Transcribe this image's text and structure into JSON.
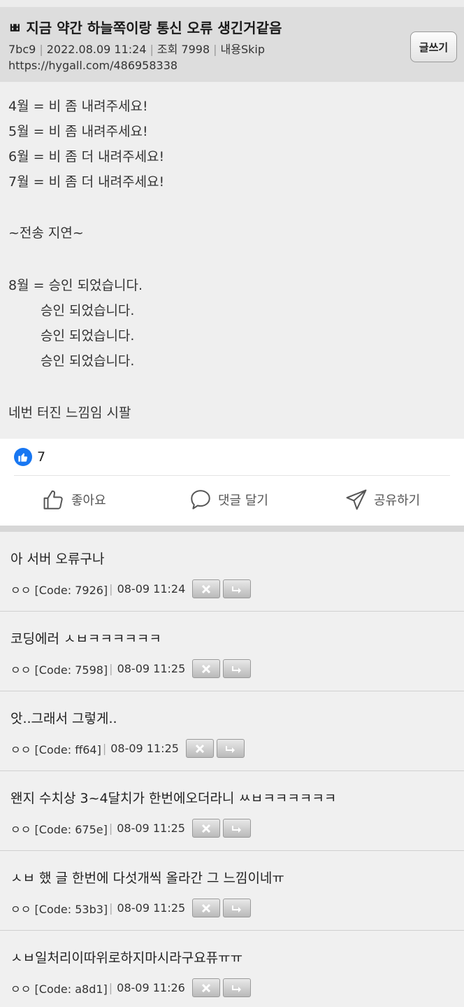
{
  "header": {
    "title": "ㅃ 지금 약간 하늘쪽이랑 통신 오류 생긴거같음",
    "meta": [
      "7bc9",
      "2022.08.09 11:24",
      "조회 7998",
      "내용Skip"
    ],
    "url": "https://hygall.com/486958338",
    "write_label": "글쓰기"
  },
  "post_lines": [
    "4월 = 비 좀 내려주세요!",
    "5월 = 비 좀 내려주세요!",
    "6월 = 비 좀 더 내려주세요!",
    "7월 = 비 좀 더 내려주세요!",
    "~전송 지연~",
    "8월 = 승인 되었습니다.",
    "승인 되었습니다.",
    "승인 되었습니다.",
    "승인 되었습니다.",
    "네번 터진 느낌임 시팔"
  ],
  "reactions": {
    "like_count": "7",
    "like_label": "좋아요",
    "comment_label": "댓글 달기",
    "share_label": "공유하기"
  },
  "comments": [
    {
      "text": "아 서버 오류구나",
      "author": "ㅇㅇ [Code: 7926]",
      "time": "08-09 11:24"
    },
    {
      "text": "코딩에러 ㅅㅂㅋㅋㅋㅋㅋㅋ",
      "author": "ㅇㅇ [Code: 7598]",
      "time": "08-09 11:25"
    },
    {
      "text": "앗..그래서 그렇게..",
      "author": "ㅇㅇ [Code: ff64]",
      "time": "08-09 11:25"
    },
    {
      "text": "왠지 수치상 3~4달치가 한번에오더라니 ㅆㅂㅋㅋㅋㅋㅋㅋ",
      "author": "ㅇㅇ [Code: 675e]",
      "time": "08-09 11:25"
    },
    {
      "text": "ㅅㅂ 했 글 한번에 다섯개씩 올라간 그 느낌이네ㅠ",
      "author": "ㅇㅇ [Code: 53b3]",
      "time": "08-09 11:25"
    },
    {
      "text": "ㅅㅂ일처리이따위로하지마시라구요퓨ㅠㅠ",
      "author": "ㅇㅇ [Code: a8d1]",
      "time": "08-09 11:26"
    }
  ],
  "colors": {
    "like_blue": "#1877f2",
    "header_bg": "#dddddd",
    "body_bg": "#efefef"
  }
}
